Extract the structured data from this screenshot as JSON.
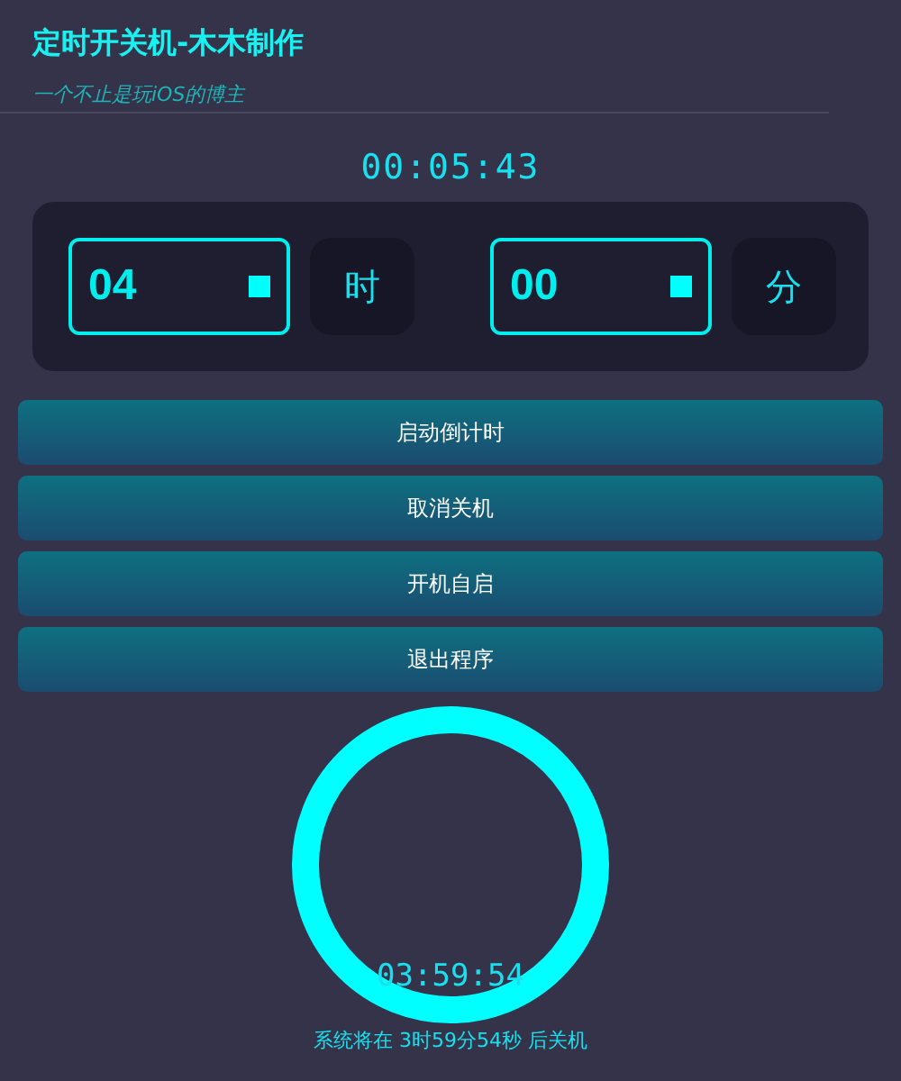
{
  "window": {
    "title": "定时开关机-木木制作",
    "subtitle": "一个不止是玩iOS的博主"
  },
  "clock": "00:05:43",
  "timer": {
    "hours": {
      "value": "04",
      "unit": "时"
    },
    "minutes": {
      "value": "00",
      "unit": "分"
    }
  },
  "buttons": [
    "启动倒计时",
    "取消关机",
    "开机自启",
    "退出程序"
  ],
  "countdown": "03:59:54",
  "status": "系统将在 3时59分54秒 后关机"
}
